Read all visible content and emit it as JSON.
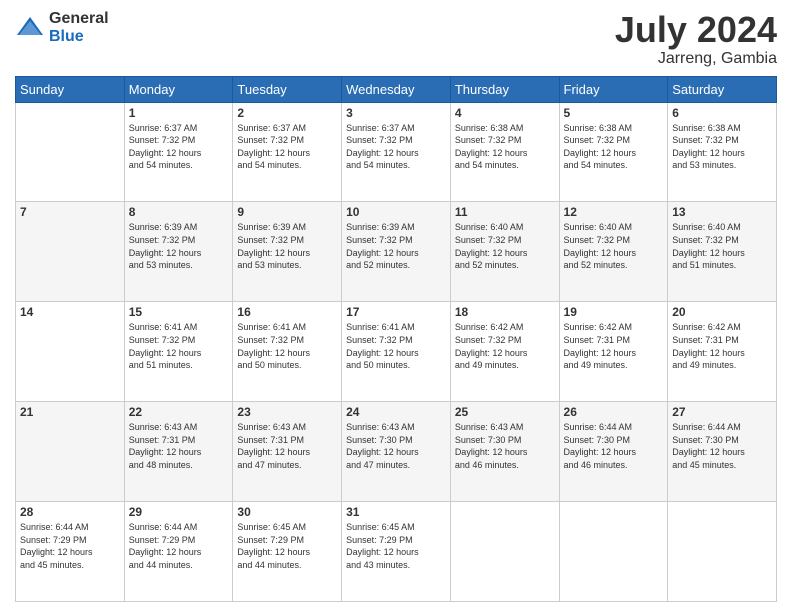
{
  "header": {
    "logo_general": "General",
    "logo_blue": "Blue",
    "title": "July 2024",
    "location": "Jarreng, Gambia"
  },
  "days_of_week": [
    "Sunday",
    "Monday",
    "Tuesday",
    "Wednesday",
    "Thursday",
    "Friday",
    "Saturday"
  ],
  "weeks": [
    [
      {
        "day": "",
        "info": ""
      },
      {
        "day": "1",
        "info": "Sunrise: 6:37 AM\nSunset: 7:32 PM\nDaylight: 12 hours\nand 54 minutes."
      },
      {
        "day": "2",
        "info": "Sunrise: 6:37 AM\nSunset: 7:32 PM\nDaylight: 12 hours\nand 54 minutes."
      },
      {
        "day": "3",
        "info": "Sunrise: 6:37 AM\nSunset: 7:32 PM\nDaylight: 12 hours\nand 54 minutes."
      },
      {
        "day": "4",
        "info": "Sunrise: 6:38 AM\nSunset: 7:32 PM\nDaylight: 12 hours\nand 54 minutes."
      },
      {
        "day": "5",
        "info": "Sunrise: 6:38 AM\nSunset: 7:32 PM\nDaylight: 12 hours\nand 54 minutes."
      },
      {
        "day": "6",
        "info": "Sunrise: 6:38 AM\nSunset: 7:32 PM\nDaylight: 12 hours\nand 53 minutes."
      }
    ],
    [
      {
        "day": "7",
        "info": ""
      },
      {
        "day": "8",
        "info": "Sunrise: 6:39 AM\nSunset: 7:32 PM\nDaylight: 12 hours\nand 53 minutes."
      },
      {
        "day": "9",
        "info": "Sunrise: 6:39 AM\nSunset: 7:32 PM\nDaylight: 12 hours\nand 53 minutes."
      },
      {
        "day": "10",
        "info": "Sunrise: 6:39 AM\nSunset: 7:32 PM\nDaylight: 12 hours\nand 52 minutes."
      },
      {
        "day": "11",
        "info": "Sunrise: 6:40 AM\nSunset: 7:32 PM\nDaylight: 12 hours\nand 52 minutes."
      },
      {
        "day": "12",
        "info": "Sunrise: 6:40 AM\nSunset: 7:32 PM\nDaylight: 12 hours\nand 52 minutes."
      },
      {
        "day": "13",
        "info": "Sunrise: 6:40 AM\nSunset: 7:32 PM\nDaylight: 12 hours\nand 51 minutes."
      }
    ],
    [
      {
        "day": "14",
        "info": ""
      },
      {
        "day": "15",
        "info": "Sunrise: 6:41 AM\nSunset: 7:32 PM\nDaylight: 12 hours\nand 51 minutes."
      },
      {
        "day": "16",
        "info": "Sunrise: 6:41 AM\nSunset: 7:32 PM\nDaylight: 12 hours\nand 50 minutes."
      },
      {
        "day": "17",
        "info": "Sunrise: 6:41 AM\nSunset: 7:32 PM\nDaylight: 12 hours\nand 50 minutes."
      },
      {
        "day": "18",
        "info": "Sunrise: 6:42 AM\nSunset: 7:32 PM\nDaylight: 12 hours\nand 49 minutes."
      },
      {
        "day": "19",
        "info": "Sunrise: 6:42 AM\nSunset: 7:31 PM\nDaylight: 12 hours\nand 49 minutes."
      },
      {
        "day": "20",
        "info": "Sunrise: 6:42 AM\nSunset: 7:31 PM\nDaylight: 12 hours\nand 49 minutes."
      }
    ],
    [
      {
        "day": "21",
        "info": ""
      },
      {
        "day": "22",
        "info": "Sunrise: 6:43 AM\nSunset: 7:31 PM\nDaylight: 12 hours\nand 48 minutes."
      },
      {
        "day": "23",
        "info": "Sunrise: 6:43 AM\nSunset: 7:31 PM\nDaylight: 12 hours\nand 47 minutes."
      },
      {
        "day": "24",
        "info": "Sunrise: 6:43 AM\nSunset: 7:30 PM\nDaylight: 12 hours\nand 47 minutes."
      },
      {
        "day": "25",
        "info": "Sunrise: 6:43 AM\nSunset: 7:30 PM\nDaylight: 12 hours\nand 46 minutes."
      },
      {
        "day": "26",
        "info": "Sunrise: 6:44 AM\nSunset: 7:30 PM\nDaylight: 12 hours\nand 46 minutes."
      },
      {
        "day": "27",
        "info": "Sunrise: 6:44 AM\nSunset: 7:30 PM\nDaylight: 12 hours\nand 45 minutes."
      }
    ],
    [
      {
        "day": "28",
        "info": "Sunrise: 6:44 AM\nSunset: 7:29 PM\nDaylight: 12 hours\nand 45 minutes."
      },
      {
        "day": "29",
        "info": "Sunrise: 6:44 AM\nSunset: 7:29 PM\nDaylight: 12 hours\nand 44 minutes."
      },
      {
        "day": "30",
        "info": "Sunrise: 6:45 AM\nSunset: 7:29 PM\nDaylight: 12 hours\nand 44 minutes."
      },
      {
        "day": "31",
        "info": "Sunrise: 6:45 AM\nSunset: 7:29 PM\nDaylight: 12 hours\nand 43 minutes."
      },
      {
        "day": "",
        "info": ""
      },
      {
        "day": "",
        "info": ""
      },
      {
        "day": "",
        "info": ""
      }
    ]
  ]
}
